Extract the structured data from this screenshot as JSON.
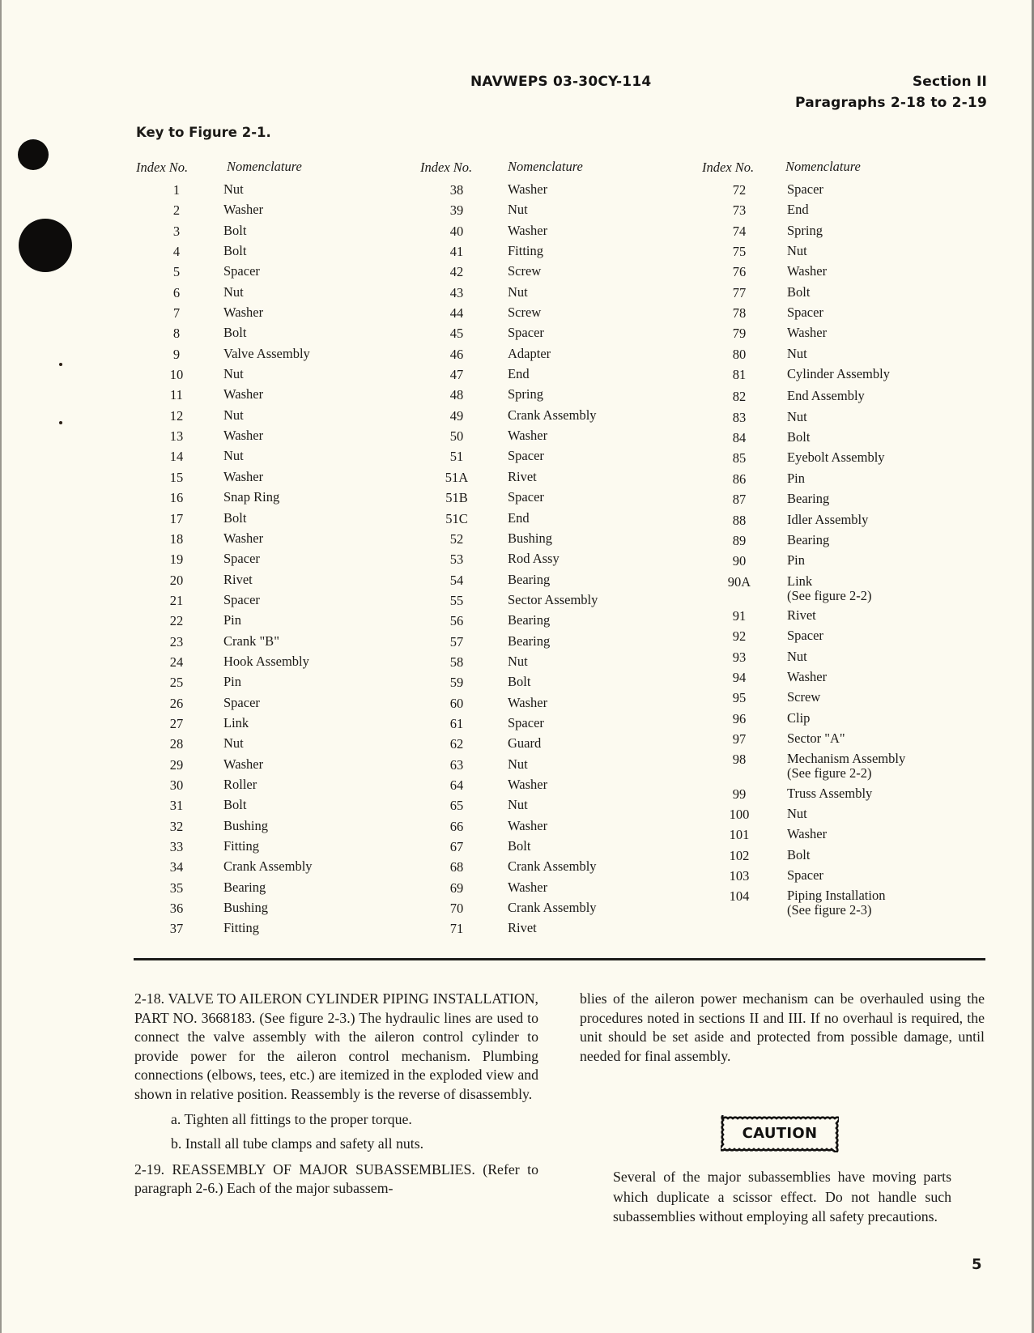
{
  "header": {
    "doc_number": "NAVWEPS 03-30CY-114",
    "section": "Section II",
    "paragraphs": "Paragraphs 2-18 to 2-19"
  },
  "key": {
    "title": "Key to Figure 2-1.",
    "col_headers": {
      "index": "Index No.",
      "nomenclature": "Nomenclature"
    },
    "columns": [
      [
        {
          "idx": "1",
          "nom": "Nut"
        },
        {
          "idx": "2",
          "nom": "Washer"
        },
        {
          "idx": "3",
          "nom": "Bolt"
        },
        {
          "idx": "4",
          "nom": "Bolt"
        },
        {
          "idx": "5",
          "nom": "Spacer"
        },
        {
          "idx": "6",
          "nom": "Nut"
        },
        {
          "idx": "7",
          "nom": "Washer"
        },
        {
          "idx": "8",
          "nom": "Bolt"
        },
        {
          "idx": "9",
          "nom": "Valve Assembly"
        },
        {
          "idx": "10",
          "nom": "Nut"
        },
        {
          "idx": "11",
          "nom": "Washer"
        },
        {
          "idx": "12",
          "nom": "Nut"
        },
        {
          "idx": "13",
          "nom": "Washer"
        },
        {
          "idx": "14",
          "nom": "Nut"
        },
        {
          "idx": "15",
          "nom": "Washer"
        },
        {
          "idx": "16",
          "nom": "Snap Ring"
        },
        {
          "idx": "17",
          "nom": "Bolt"
        },
        {
          "idx": "18",
          "nom": "Washer"
        },
        {
          "idx": "19",
          "nom": "Spacer"
        },
        {
          "idx": "20",
          "nom": "Rivet"
        },
        {
          "idx": "21",
          "nom": "Spacer"
        },
        {
          "idx": "22",
          "nom": "Pin"
        },
        {
          "idx": "23",
          "nom": "Crank \"B\""
        },
        {
          "idx": "24",
          "nom": "Hook Assembly"
        },
        {
          "idx": "25",
          "nom": "Pin"
        },
        {
          "idx": "26",
          "nom": "Spacer"
        },
        {
          "idx": "27",
          "nom": "Link"
        },
        {
          "idx": "28",
          "nom": "Nut"
        },
        {
          "idx": "29",
          "nom": "Washer"
        },
        {
          "idx": "30",
          "nom": "Roller"
        },
        {
          "idx": "31",
          "nom": "Bolt"
        },
        {
          "idx": "32",
          "nom": "Bushing"
        },
        {
          "idx": "33",
          "nom": "Fitting"
        },
        {
          "idx": "34",
          "nom": "Crank Assembly"
        },
        {
          "idx": "35",
          "nom": "Bearing"
        },
        {
          "idx": "36",
          "nom": "Bushing"
        },
        {
          "idx": "37",
          "nom": "Fitting"
        }
      ],
      [
        {
          "idx": "38",
          "nom": "Washer"
        },
        {
          "idx": "39",
          "nom": "Nut"
        },
        {
          "idx": "40",
          "nom": "Washer"
        },
        {
          "idx": "41",
          "nom": "Fitting"
        },
        {
          "idx": "42",
          "nom": "Screw"
        },
        {
          "idx": "43",
          "nom": "Nut"
        },
        {
          "idx": "44",
          "nom": "Screw"
        },
        {
          "idx": "45",
          "nom": "Spacer"
        },
        {
          "idx": "46",
          "nom": "Adapter"
        },
        {
          "idx": "47",
          "nom": "End"
        },
        {
          "idx": "48",
          "nom": "Spring"
        },
        {
          "idx": "49",
          "nom": "Crank Assembly"
        },
        {
          "idx": "50",
          "nom": "Washer"
        },
        {
          "idx": "51",
          "nom": "Spacer"
        },
        {
          "idx": "51A",
          "nom": "Rivet"
        },
        {
          "idx": "51B",
          "nom": "Spacer"
        },
        {
          "idx": "51C",
          "nom": "End"
        },
        {
          "idx": "52",
          "nom": "Bushing"
        },
        {
          "idx": "53",
          "nom": "Rod Assy"
        },
        {
          "idx": "54",
          "nom": "Bearing"
        },
        {
          "idx": "55",
          "nom": "Sector Assembly"
        },
        {
          "idx": "56",
          "nom": "Bearing"
        },
        {
          "idx": "57",
          "nom": "Bearing"
        },
        {
          "idx": "58",
          "nom": "Nut"
        },
        {
          "idx": "59",
          "nom": "Bolt"
        },
        {
          "idx": "60",
          "nom": "Washer"
        },
        {
          "idx": "61",
          "nom": "Spacer"
        },
        {
          "idx": "62",
          "nom": "Guard"
        },
        {
          "idx": "63",
          "nom": "Nut"
        },
        {
          "idx": "64",
          "nom": "Washer"
        },
        {
          "idx": "65",
          "nom": "Nut"
        },
        {
          "idx": "66",
          "nom": "Washer"
        },
        {
          "idx": "67",
          "nom": "Bolt"
        },
        {
          "idx": "68",
          "nom": "Crank Assembly"
        },
        {
          "idx": "69",
          "nom": "Washer"
        },
        {
          "idx": "70",
          "nom": "Crank Assembly"
        },
        {
          "idx": "71",
          "nom": "Rivet"
        }
      ],
      [
        {
          "idx": "72",
          "nom": "Spacer"
        },
        {
          "idx": "73",
          "nom": "End"
        },
        {
          "idx": "74",
          "nom": "Spring"
        },
        {
          "idx": "75",
          "nom": "Nut"
        },
        {
          "idx": "76",
          "nom": "Washer"
        },
        {
          "idx": "77",
          "nom": "Bolt"
        },
        {
          "idx": "78",
          "nom": "Spacer"
        },
        {
          "idx": "79",
          "nom": "Washer"
        },
        {
          "idx": "80",
          "nom": "Nut"
        },
        {
          "idx": "81",
          "nom": "Cylinder Assembly"
        },
        {
          "idx": "82",
          "nom": "End Assembly"
        },
        {
          "idx": "83",
          "nom": "Nut"
        },
        {
          "idx": "84",
          "nom": "Bolt"
        },
        {
          "idx": "85",
          "nom": "Eyebolt Assembly"
        },
        {
          "idx": "86",
          "nom": "Pin"
        },
        {
          "idx": "87",
          "nom": "Bearing"
        },
        {
          "idx": "88",
          "nom": "Idler Assembly"
        },
        {
          "idx": "89",
          "nom": "Bearing"
        },
        {
          "idx": "90",
          "nom": "Pin"
        },
        {
          "idx": "90A",
          "nom": "Link",
          "note": "(See figure 2-2)"
        },
        {
          "idx": "91",
          "nom": "Rivet"
        },
        {
          "idx": "92",
          "nom": "Spacer"
        },
        {
          "idx": "93",
          "nom": "Nut"
        },
        {
          "idx": "94",
          "nom": "Washer"
        },
        {
          "idx": "95",
          "nom": "Screw"
        },
        {
          "idx": "96",
          "nom": "Clip"
        },
        {
          "idx": "97",
          "nom": "Sector \"A\""
        },
        {
          "idx": "98",
          "nom": "Mechanism Assembly",
          "note": "(See figure 2-2)"
        },
        {
          "idx": "99",
          "nom": "Truss Assembly"
        },
        {
          "idx": "100",
          "nom": "Nut"
        },
        {
          "idx": "101",
          "nom": "Washer"
        },
        {
          "idx": "102",
          "nom": "Bolt"
        },
        {
          "idx": "103",
          "nom": "Spacer"
        },
        {
          "idx": "104",
          "nom": "Piping Installation",
          "note": "(See figure 2-3)"
        }
      ]
    ]
  },
  "body": {
    "para_2_18": "2-18. VALVE TO AILERON CYLINDER PIPING INSTALLATION, PART NO. 3668183. (See figure 2-3.) The hydraulic lines are used to connect the valve assembly with the aileron control cylinder to provide power for the aileron control mechanism. Plumbing connections (elbows, tees, etc.) are itemized in the exploded view and shown in relative position. Reassembly is the reverse of disassembly.",
    "step_a": "a. Tighten all fittings to the proper torque.",
    "step_b": "b. Install all tube clamps and safety all nuts.",
    "para_2_19_start": "2-19. REASSEMBLY OF MAJOR SUBASSEMBLIES. (Refer to paragraph 2-6.) Each of the major subassem-",
    "para_2_19_cont": "blies of the aileron power mechanism can be overhauled using the procedures noted in sections II and III. If no overhaul is required, the unit should be set aside and protected from possible damage, until needed for final assembly."
  },
  "caution": {
    "label": "CAUTION",
    "text": "Several of the major subassemblies have moving parts which duplicate a scissor effect. Do not handle such subassemblies without employing all safety precautions."
  },
  "page_number": "5"
}
